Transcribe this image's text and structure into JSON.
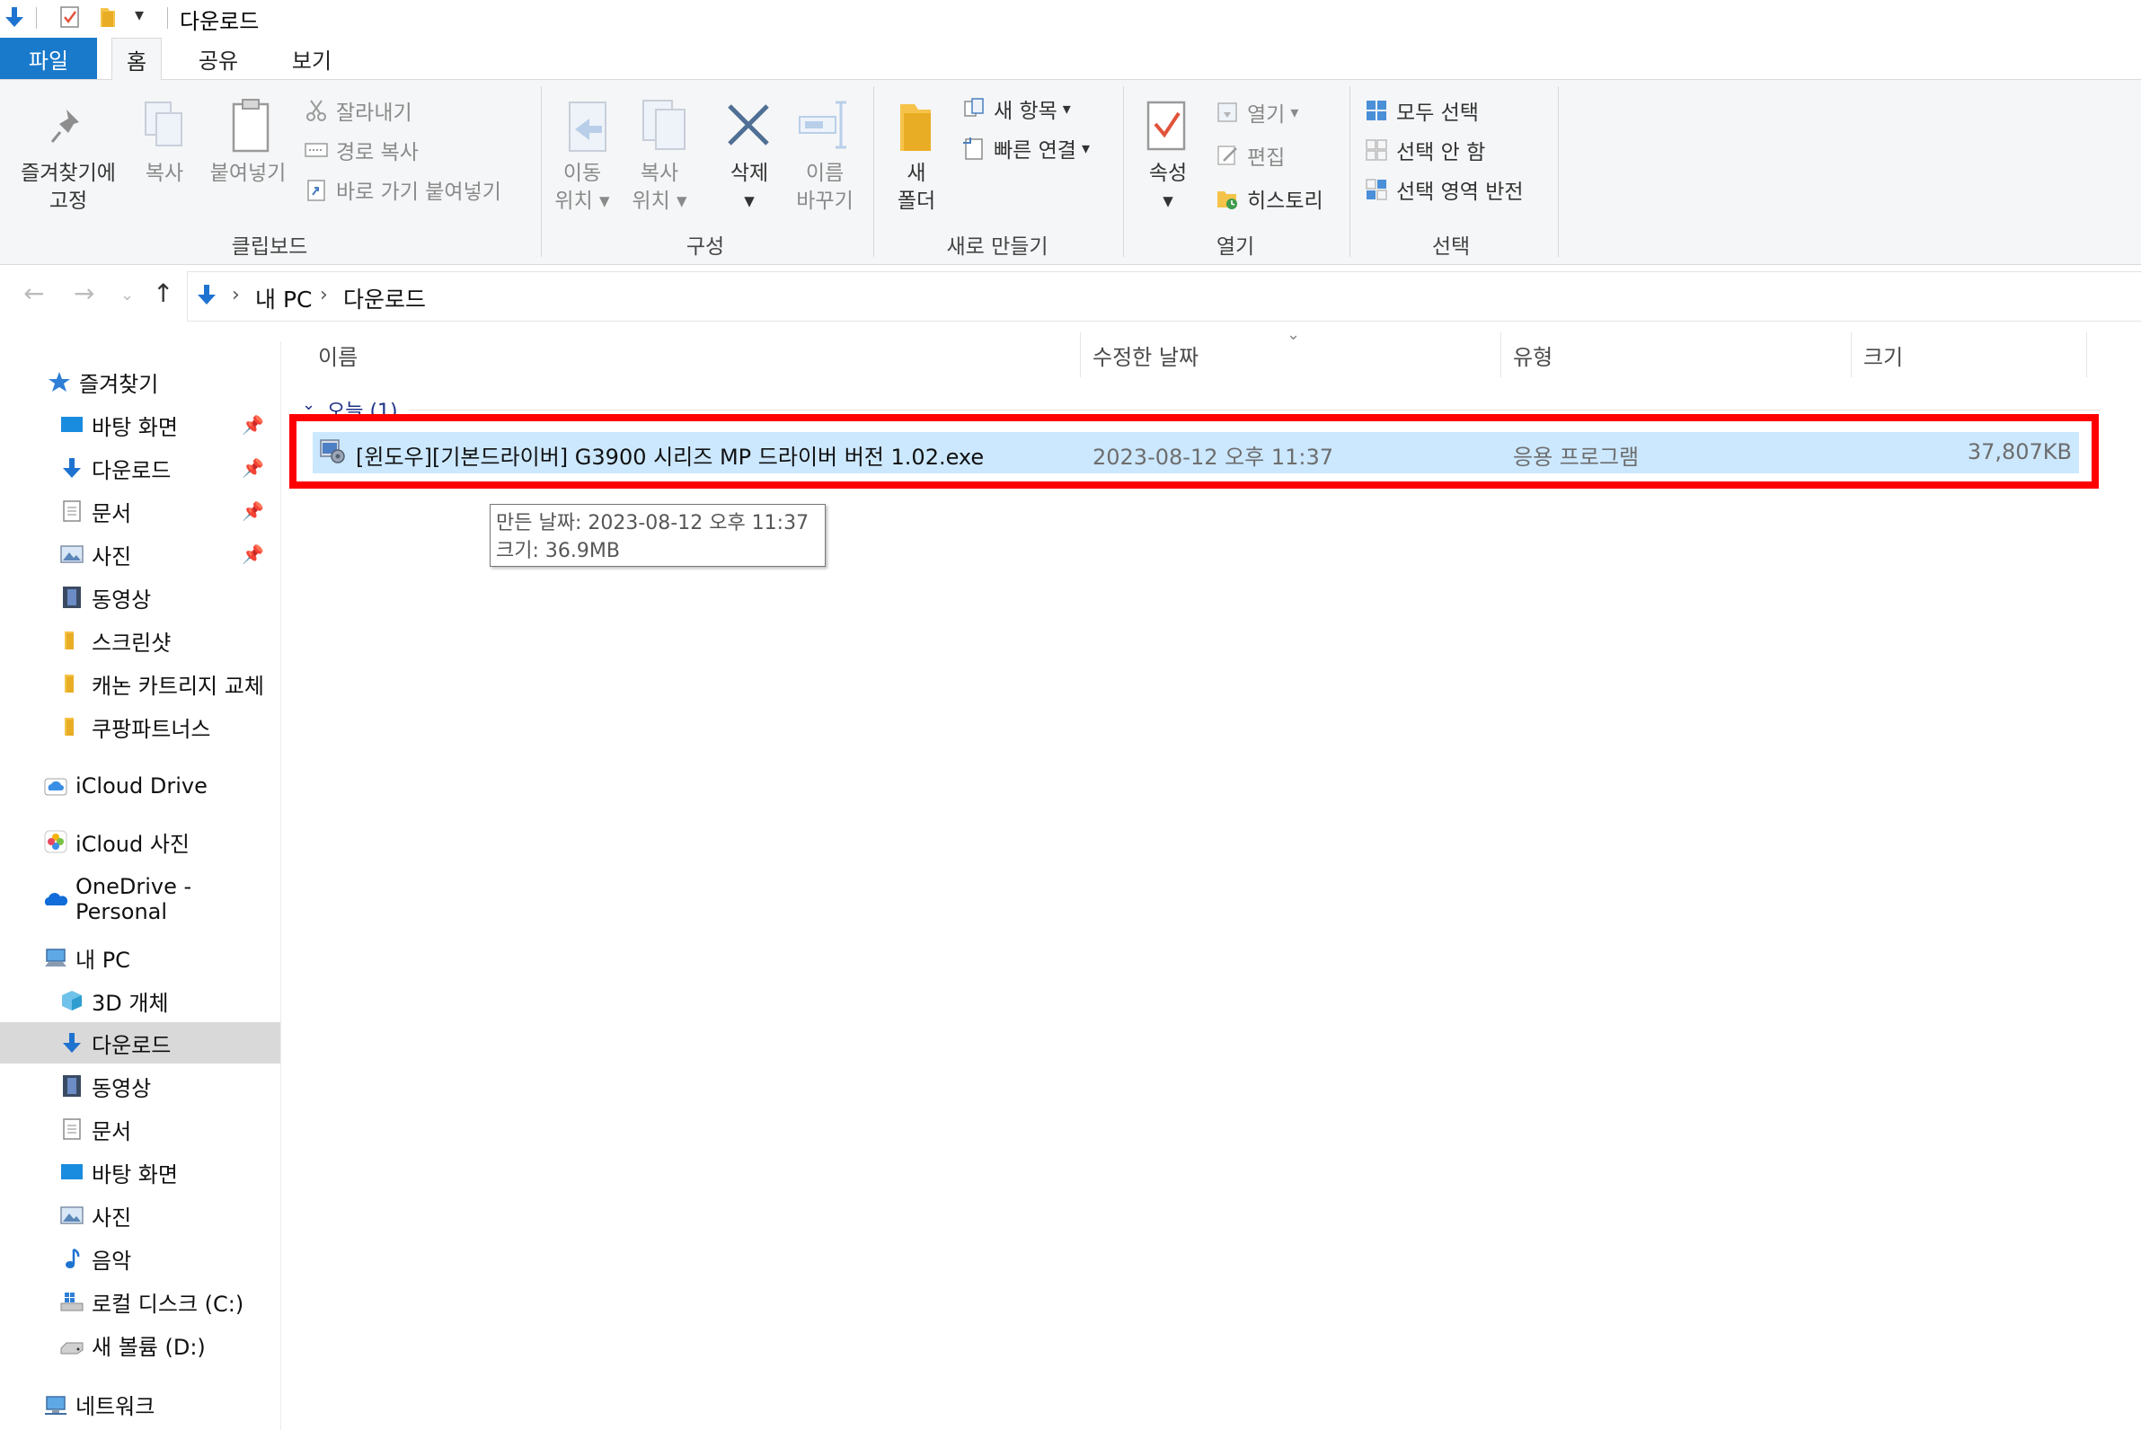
{
  "window": {
    "title": "다운로드"
  },
  "tabs": [
    {
      "label": "파일"
    },
    {
      "label": "홈"
    },
    {
      "label": "공유"
    },
    {
      "label": "보기"
    }
  ],
  "ribbon": {
    "clipboard": {
      "group_label": "클립보드",
      "pin_label_1": "즐겨찾기에",
      "pin_label_2": "고정",
      "copy_label": "복사",
      "paste_label": "붙여넣기",
      "cut_label": "잘라내기",
      "copy_path_label": "경로 복사",
      "paste_shortcut_label": "바로 가기 붙여넣기"
    },
    "organize": {
      "group_label": "구성",
      "move_to_1": "이동",
      "move_to_2": "위치",
      "copy_to_1": "복사",
      "copy_to_2": "위치",
      "delete_label": "삭제",
      "rename_1": "이름",
      "rename_2": "바꾸기"
    },
    "new": {
      "group_label": "새로 만들기",
      "new_folder_1": "새",
      "new_folder_2": "폴더",
      "new_item_label": "새 항목",
      "easy_access_label": "빠른 연결"
    },
    "open": {
      "group_label": "열기",
      "properties_label": "속성",
      "open_label": "열기",
      "edit_label": "편집",
      "history_label": "히스토리"
    },
    "select": {
      "group_label": "선택",
      "select_all_label": "모두 선택",
      "select_none_label": "선택 안 함",
      "invert_label": "선택 영역 반전"
    }
  },
  "address": {
    "crumbs": [
      "내 PC",
      "다운로드"
    ]
  },
  "sidebar": {
    "quick_access": {
      "label": "즐겨찾기",
      "items": [
        {
          "label": "바탕 화면",
          "pinned": true
        },
        {
          "label": "다운로드",
          "pinned": true
        },
        {
          "label": "문서",
          "pinned": true
        },
        {
          "label": "사진",
          "pinned": true
        },
        {
          "label": "동영상",
          "pinned": false
        },
        {
          "label": "스크린샷",
          "pinned": false
        },
        {
          "label": "캐논 카트리지 교체",
          "pinned": false
        },
        {
          "label": "쿠팡파트너스",
          "pinned": false
        }
      ]
    },
    "icloud_drive": "iCloud Drive",
    "icloud_photos": "iCloud 사진",
    "onedrive": "OneDrive - Personal",
    "this_pc": {
      "label": "내 PC",
      "items": [
        {
          "label": "3D 개체"
        },
        {
          "label": "다운로드",
          "selected": true
        },
        {
          "label": "동영상"
        },
        {
          "label": "문서"
        },
        {
          "label": "바탕 화면"
        },
        {
          "label": "사진"
        },
        {
          "label": "음악"
        },
        {
          "label": "로컬 디스크 (C:)"
        },
        {
          "label": "새 볼륨 (D:)"
        }
      ]
    },
    "network": "네트워크"
  },
  "file_list": {
    "columns": {
      "name": "이름",
      "modified": "수정한 날짜",
      "type": "유형",
      "size": "크기"
    },
    "group_header": "오늘 (1)",
    "rows": [
      {
        "name": "[윈도우][기본드라이버] G3900 시리즈 MP 드라이버 버전 1.02.exe",
        "modified": "2023-08-12 오후 11:37",
        "type": "응용 프로그램",
        "size": "37,807KB",
        "selected": true
      }
    ]
  },
  "tooltip": {
    "line1": "만든 날짜: 2023-08-12 오후 11:37",
    "line2": "크기: 36.9MB"
  },
  "colors": {
    "file_tab": "#1979ca",
    "selection": "#cce8ff",
    "highlight_box": "#ff0000",
    "nav_selected": "#d9d9d9"
  }
}
